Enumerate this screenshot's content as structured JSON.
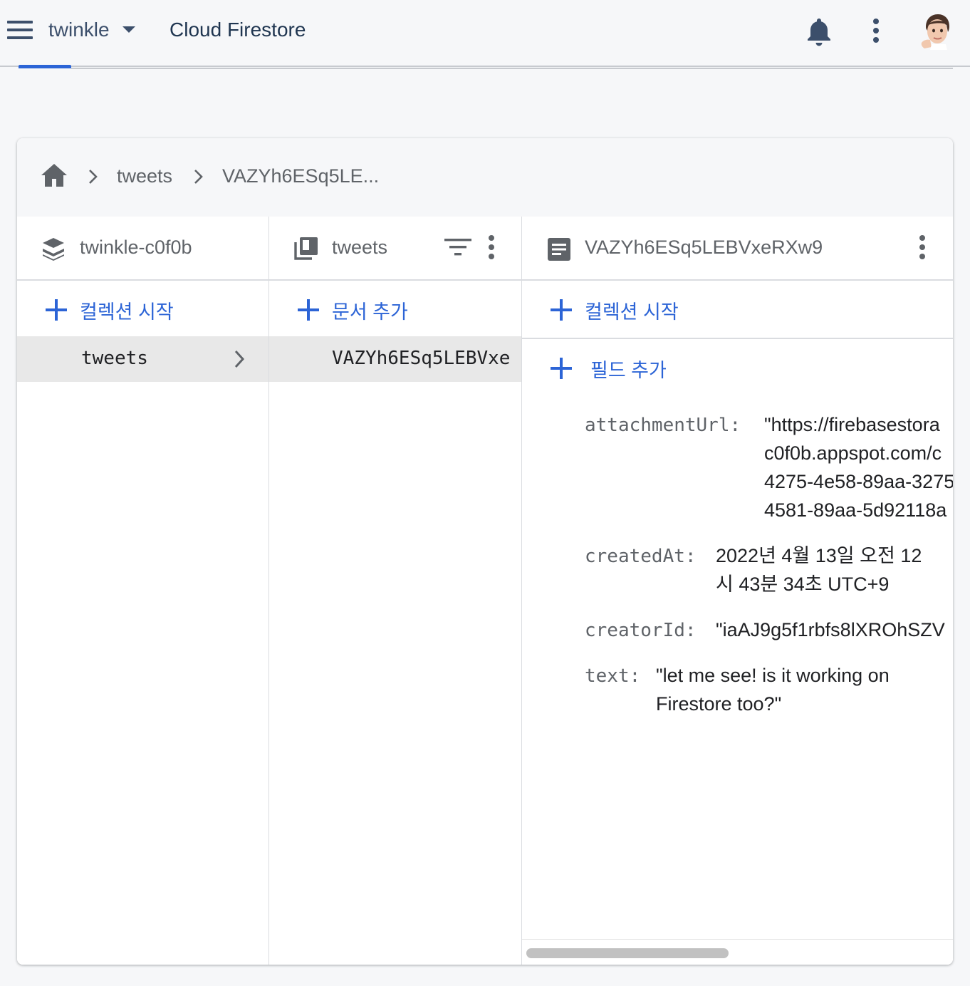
{
  "header": {
    "project_name": "twinkle",
    "product_title": "Cloud Firestore"
  },
  "breadcrumb": {
    "items": [
      "tweets",
      "VAZYh6ESq5LE..."
    ]
  },
  "columns": {
    "root": {
      "title": "twinkle-c0f0b",
      "add_label": "컬렉션 시작",
      "items": [
        "tweets"
      ]
    },
    "collection": {
      "title": "tweets",
      "add_label": "문서 추가",
      "items": [
        "VAZYh6ESq5LEBVxe"
      ]
    },
    "document": {
      "title": "VAZYh6ESq5LEBVxeRXw9",
      "add_collection_label": "컬렉션 시작",
      "add_field_label": "필드 추가",
      "fields": [
        {
          "key": "attachmentUrl:",
          "value": "\"https://firebasestora\nc0f0b.appspot.com/c\n4275-4e58-89aa-3275\n4581-89aa-5d92118a"
        },
        {
          "key": "createdAt:",
          "value": "2022년 4월 13일 오전 12\n시 43분 34초 UTC+9"
        },
        {
          "key": "creatorId:",
          "value": "\"iaAJ9g5f1rbfs8lXROhSZV"
        },
        {
          "key": "text:",
          "value": "\"let me see! is it working on\nFirestore too?\""
        }
      ]
    }
  },
  "colors": {
    "accent": "#2c64d6",
    "header_text": "#3c4f6b",
    "selected_row": "#e8e8e8"
  }
}
